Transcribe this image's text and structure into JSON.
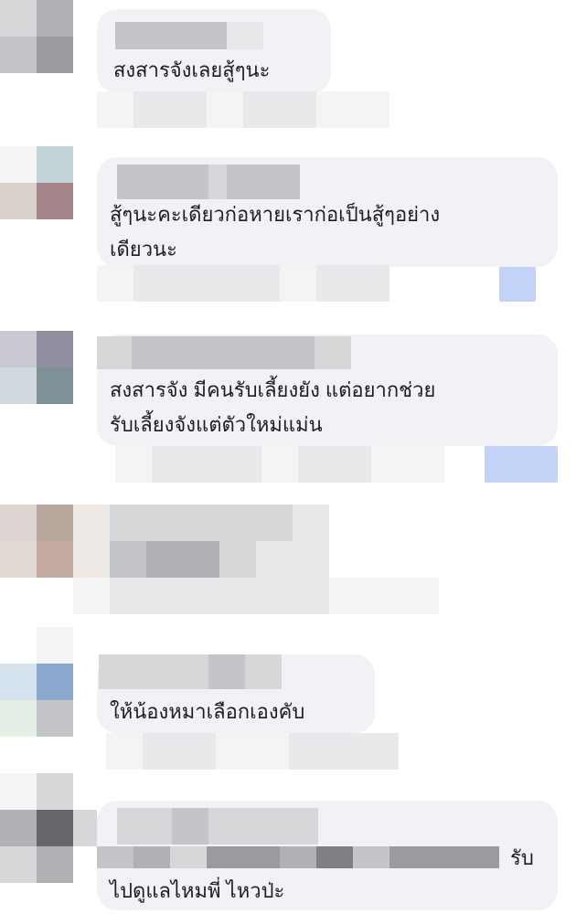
{
  "comments": [
    {
      "text_lines": [
        "สงสารจังเลยสู้ๆนะ"
      ]
    },
    {
      "text_lines": [
        "สู้ๆนะคะเดียวก่อหายเราก่อเป็นสู้ๆอย่าง",
        "เดียวนะ"
      ]
    },
    {
      "text_lines": [
        "สงสารจัง มีคนรับเลี้ยงยัง แต่อยากช่วย",
        "รับเลี้ยงจังแต่ตัวใหม่แม่น"
      ]
    },
    {
      "text_lines": []
    },
    {
      "text_lines": [
        "ให้น้องหมาเลือกเองคับ"
      ]
    },
    {
      "text_lines": [
        "รับ",
        "ไปดูแลไหมพี่ ไหวป่ะ"
      ]
    }
  ],
  "colors": {
    "bubble": "#f0f2f5",
    "text": "#1c1e21",
    "reaction_blue": "#c2d3f7"
  }
}
